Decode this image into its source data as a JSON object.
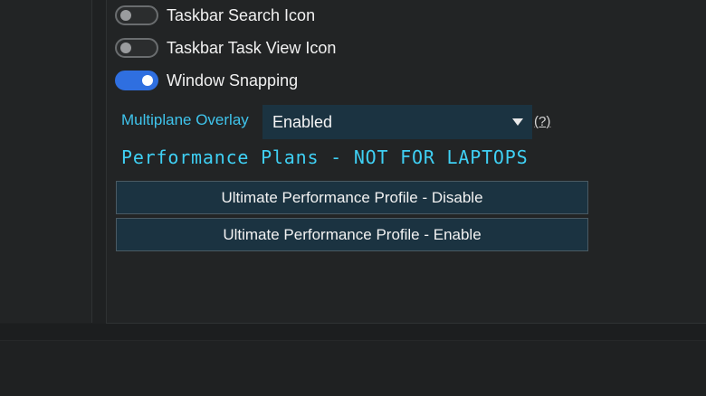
{
  "toggles": [
    {
      "label": "Taskbar Search Icon",
      "state": "off"
    },
    {
      "label": "Taskbar Task View Icon",
      "state": "off"
    },
    {
      "label": "Window Snapping",
      "state": "on"
    }
  ],
  "multiplane_overlay": {
    "label": "Multiplane Overlay",
    "selected": "Enabled",
    "help": "(?)"
  },
  "performance_plans": {
    "heading": "Performance Plans - NOT FOR LAPTOPS",
    "buttons": [
      "Ultimate Performance Profile - Disable",
      "Ultimate Performance Profile - Enable"
    ]
  },
  "colors": {
    "accent_cyan": "#3fc4ec",
    "toggle_on": "#2f6fe0",
    "control_bg": "#1b3341",
    "background": "#1f2122"
  }
}
